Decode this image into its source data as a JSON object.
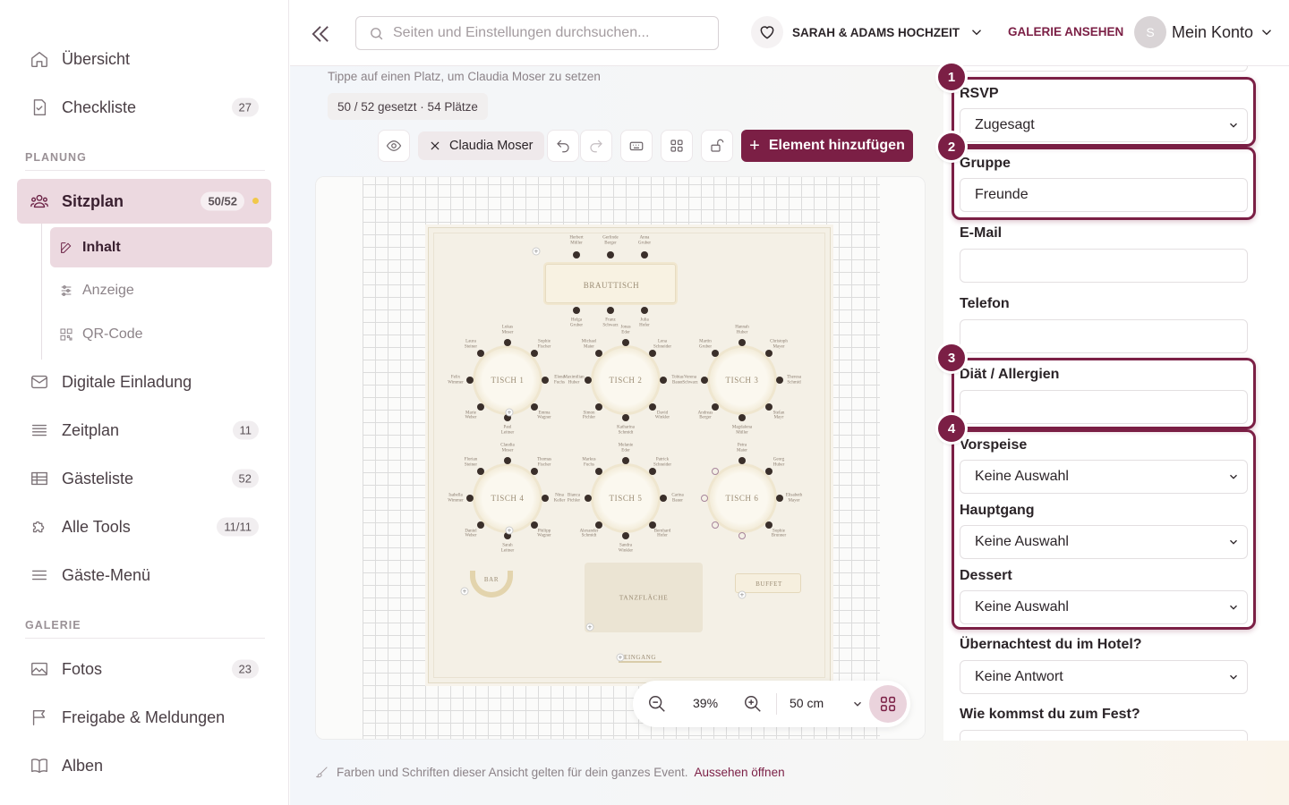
{
  "sidebar": {
    "items": [
      {
        "label": "Übersicht",
        "icon": "home-icon"
      },
      {
        "label": "Checkliste",
        "icon": "checklist-icon",
        "badge": "27"
      }
    ],
    "planning_title": "PLANUNG",
    "seating": {
      "label": "Sitzplan",
      "badge": "50/52",
      "icon": "people-icon"
    },
    "sub_items": [
      {
        "label": "Inhalt",
        "icon": "edit-icon"
      },
      {
        "label": "Anzeige",
        "icon": "sliders-icon"
      },
      {
        "label": "QR-Code",
        "icon": "qr-code-icon"
      }
    ],
    "planning_items": [
      {
        "label": "Digitale Einladung",
        "icon": "mail-icon"
      },
      {
        "label": "Zeitplan",
        "icon": "list-icon",
        "badge": "11"
      },
      {
        "label": "Gästeliste",
        "icon": "table-icon",
        "badge": "52"
      },
      {
        "label": "Alle Tools",
        "icon": "puzzle-icon",
        "badge": "11/11"
      },
      {
        "label": "Gäste-Menü",
        "icon": "menu-icon"
      }
    ],
    "gallery_title": "GALERIE",
    "gallery_items": [
      {
        "label": "Fotos",
        "icon": "image-icon",
        "badge": "23"
      },
      {
        "label": "Freigabe & Meldungen",
        "icon": "flag-icon"
      },
      {
        "label": "Alben",
        "icon": "book-icon"
      }
    ]
  },
  "topbar": {
    "search_placeholder": "Seiten und Einstellungen durchsuchen...",
    "event_name": "SARAH & ADAMS HOCHZEIT",
    "gallery_link": "GALERIE ANSEHEN",
    "avatar_letter": "S",
    "account_label": "Mein Konto"
  },
  "editor": {
    "hint": "Tippe auf einen Platz, um Claudia Moser zu setzen",
    "count": "50 / 52 gesetzt · 54 Plätze",
    "selected_guest": "Claudia Moser",
    "add_element": "Element hinzufügen",
    "zoom": "39%",
    "grid_size": "50 cm"
  },
  "floorplan": {
    "head_table": "BRAUTTISCH",
    "tables": [
      "TISCH 1",
      "TISCH 2",
      "TISCH 3",
      "TISCH 4",
      "TISCH 5",
      "TISCH 6"
    ],
    "bar": "BAR",
    "buffet": "BUFFET",
    "dancefloor": "TANZFLÄCHE",
    "entrance": "EINGANG",
    "head_top": [
      "Herbert\nMüller",
      "Gerlinde\nBerger",
      "Anna\nGruber"
    ],
    "head_bottom": [
      "Helga\nGruber",
      "Franz\nSchwarz",
      "Julia\nHofer"
    ],
    "t1": [
      "Lukas\nMoser",
      "Sophie\nFischer",
      "Elena\nFuchs",
      "Emma\nWagner",
      "Paul\nLeitner",
      "Marie\nWeber",
      "Felix\nWimmer",
      "Laura\nSteiner"
    ],
    "t2": [
      "Jonas\nEder",
      "Lena\nSchneider",
      "Tobias\nBauer",
      "David\nWinkler",
      "Katharina\nSchmidt",
      "Simon\nPichler",
      "Maximilian\nHuber",
      "Michael\nMaier"
    ],
    "t3": [
      "Hannah\nHuber",
      "Christoph\nMayer",
      "Theresa\nSchmid",
      "Stefan\nMayr",
      "Magdalena\nMüller",
      "Andreas\nBerger",
      "Verena\nSchwarz",
      "Martin\nGruber"
    ],
    "t4": [
      "Claudia\nMoser",
      "Thomas\nFischer",
      "Nina\nKeller",
      "Philipp\nWagner",
      "Sarah\nLeitner",
      "Daniel\nWeber",
      "Isabella\nWimmer",
      "Florian\nSteiner"
    ],
    "t5": [
      "Melanie\nEder",
      "Patrick\nSchneider",
      "Carina\nBauer",
      "Bernhard\nHofer",
      "Sandra\nWinkler",
      "Alexander\nSchmidt",
      "Bianca\nPichler",
      "Markus\nFuchs"
    ],
    "t6": [
      "Petra\nMaier",
      "Georg\nHuber",
      "Elisabeth\nMayer",
      "Sophie\nBrunner"
    ]
  },
  "form": {
    "rsvp_label": "RSVP",
    "rsvp_value": "Zugesagt",
    "group_label": "Gruppe",
    "group_value": "Freunde",
    "email_label": "E-Mail",
    "email_value": "",
    "phone_label": "Telefon",
    "phone_value": "",
    "diet_label": "Diät / Allergien",
    "diet_value": "",
    "starter_label": "Vorspeise",
    "starter_value": "Keine Auswahl",
    "main_label": "Hauptgang",
    "main_value": "Keine Auswahl",
    "dessert_label": "Dessert",
    "dessert_value": "Keine Auswahl",
    "hotel_label": "Übernachtest du im Hotel?",
    "hotel_value": "Keine Antwort",
    "travel_label": "Wie kommst du zum Fest?"
  },
  "markers": [
    "1",
    "2",
    "3",
    "4"
  ],
  "footer": {
    "note": "Farben und Schriften dieser Ansicht gelten für dein ganzes Event.",
    "link": "Aussehen öffnen"
  },
  "colors": {
    "accent": "#7b1f45",
    "accent_light": "#ecd9e0"
  }
}
